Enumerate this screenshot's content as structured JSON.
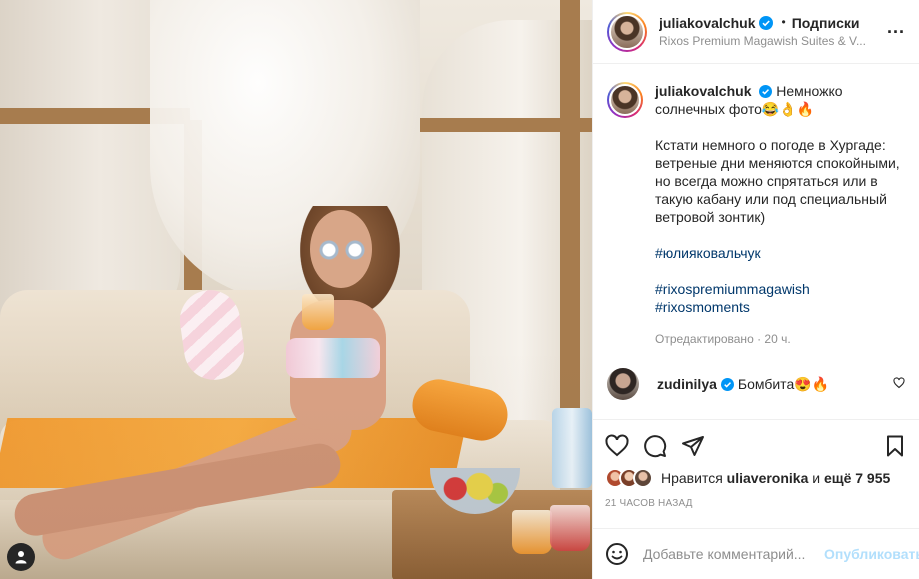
{
  "post": {
    "author": {
      "username": "juliakovalchuk",
      "follow_label": "Подписки",
      "location": "Rixos Premium Magawish Suites & V..."
    },
    "menu_glyph": "...",
    "caption": {
      "intro": "Немножко солнечных фото😂👌🔥",
      "paragraph": "Кстати немного о погоде в Хургаде: ветреные дни меняются спокойными, но всегда можно спрятаться или в такую кабану или под специальный ветровой зонтик)",
      "hashtag1": "#юлияковальчук",
      "hashtag2": "#rixospremiummagawish",
      "hashtag3": "#rixosmoments",
      "meta": "Отредактировано · 20 ч."
    },
    "comment": {
      "username": "zudinilya",
      "text": "Бомбита😍🔥"
    },
    "likes": {
      "prefix": "Нравится",
      "user": "uliaveronika",
      "connector": "и",
      "others": "ещё 7 955"
    },
    "timestamp": "21 ЧАСОВ НАЗАД",
    "add_comment": {
      "placeholder": "Добавьте комментарий...",
      "publish_label": "Опубликовать"
    }
  },
  "colors": {
    "verified": "#0095f6",
    "link": "#00376b",
    "secondary": "#8e8e8e",
    "publish_disabled": "#b2dffc"
  },
  "icons": [
    "user-tag-icon",
    "verified-badge-icon",
    "more-options-icon",
    "heart-icon",
    "comment-icon",
    "share-icon",
    "bookmark-icon",
    "emoji-icon"
  ]
}
